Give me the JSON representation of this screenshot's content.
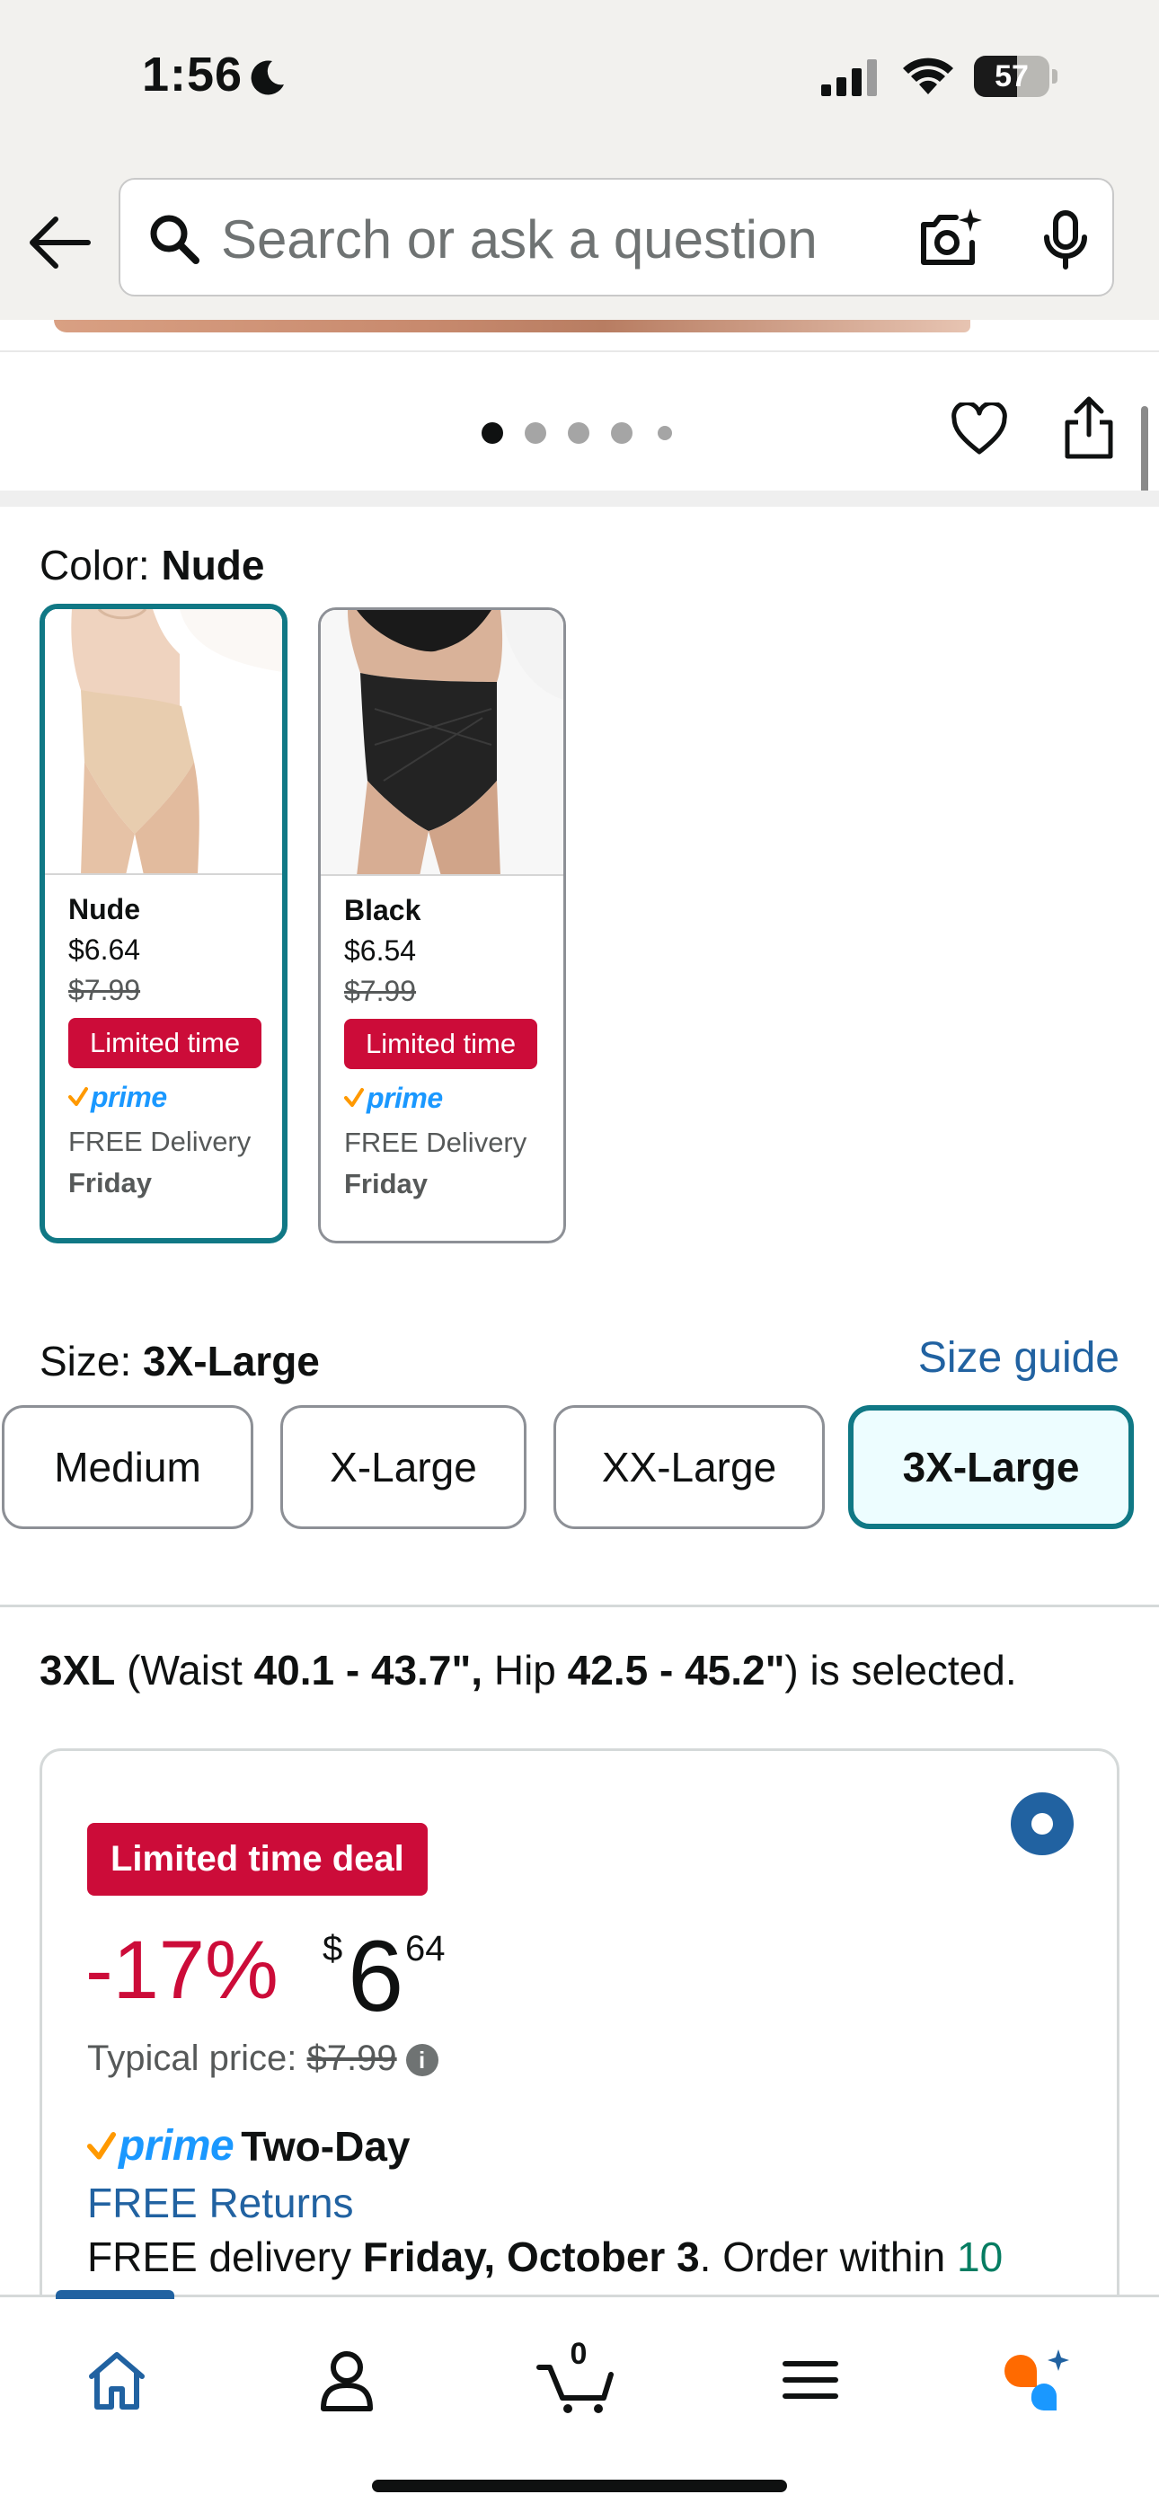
{
  "status_bar": {
    "time": "1:56",
    "battery": "57",
    "battery_level": 0.57
  },
  "search": {
    "placeholder": "Search or ask a question"
  },
  "image_carousel": {
    "dot_count": 5,
    "active_index": 0
  },
  "color": {
    "label": "Color: ",
    "selected": "Nude",
    "options": [
      {
        "name": "Nude",
        "price": "$6.64",
        "list_price": "$7.99",
        "badge": "Limited time",
        "prime": "prime",
        "delivery": "FREE Delivery",
        "day": "Friday",
        "selected": true
      },
      {
        "name": "Black",
        "price": "$6.54",
        "list_price": "$7.99",
        "badge": "Limited time",
        "prime": "prime",
        "delivery": "FREE Delivery",
        "day": "Friday",
        "selected": false
      }
    ]
  },
  "size": {
    "label": "Size: ",
    "selected": "3X-Large",
    "guide_link": "Size guide",
    "options": [
      "Medium",
      "X-Large",
      "XX-Large",
      "3X-Large"
    ],
    "description": {
      "code": "3XL",
      "open": " (Waist ",
      "waist": "40.1 - 43.7\",",
      "hip_label": " Hip ",
      "hip": "42.5 - 45.2\"",
      "tail": ") is selected."
    }
  },
  "offer": {
    "badge": "Limited time deal",
    "discount": "-17%",
    "price_symbol": "$",
    "price_whole": "6",
    "price_fraction": "64",
    "typical_label": "Typical price: ",
    "typical_price": "$7.99",
    "info": "i",
    "prime": "prime",
    "shipping": "Two-Day",
    "free_returns": "FREE Returns",
    "delivery_prefix": "FREE delivery ",
    "delivery_date": "Friday, October 3",
    "delivery_suffix": ". Order within ",
    "countdown": "10"
  },
  "bottom_nav": {
    "cart_count": "0",
    "items": [
      "home",
      "account",
      "cart",
      "menu",
      "rufus"
    ]
  },
  "colors": {
    "selected_border": "#107885",
    "deal_red": "#cc0c39",
    "link_blue": "#2162a1",
    "prime_blue": "#1a98ff",
    "prime_orange": "#ff9900"
  }
}
